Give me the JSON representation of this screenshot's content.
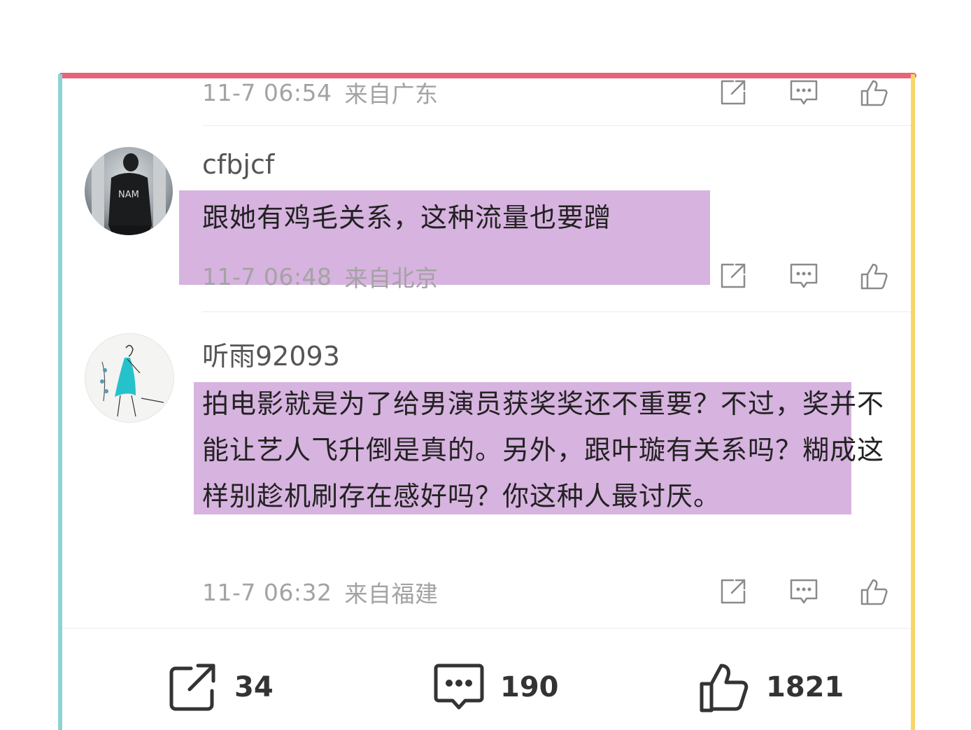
{
  "colors": {
    "top_frame": "#e6647a",
    "left_frame": "#8ed2d6",
    "right_frame": "#f8d768",
    "highlight": "#c896d2"
  },
  "comments": [
    {
      "username": "",
      "time": "11-7 06:54",
      "location": "来自广东"
    },
    {
      "username": "cfbjcf",
      "text": "跟她有鸡毛关系，这种流量也要蹭",
      "time": "11-7 06:48",
      "location": "来自北京"
    },
    {
      "username": "听雨92093",
      "text": "拍电影就是为了给男演员获奖奖还不重要？不过，奖并不能让艺人飞升倒是真的。另外，跟叶璇有关系吗？糊成这样别趁机刷存在感好吗？你这种人最讨厌。",
      "time": "11-7 06:32",
      "location": "来自福建"
    }
  ],
  "action_icons": [
    "share-icon",
    "comment-icon",
    "like-icon"
  ],
  "bottom_bar": {
    "share_count": "34",
    "comment_count": "190",
    "like_count": "1821"
  }
}
